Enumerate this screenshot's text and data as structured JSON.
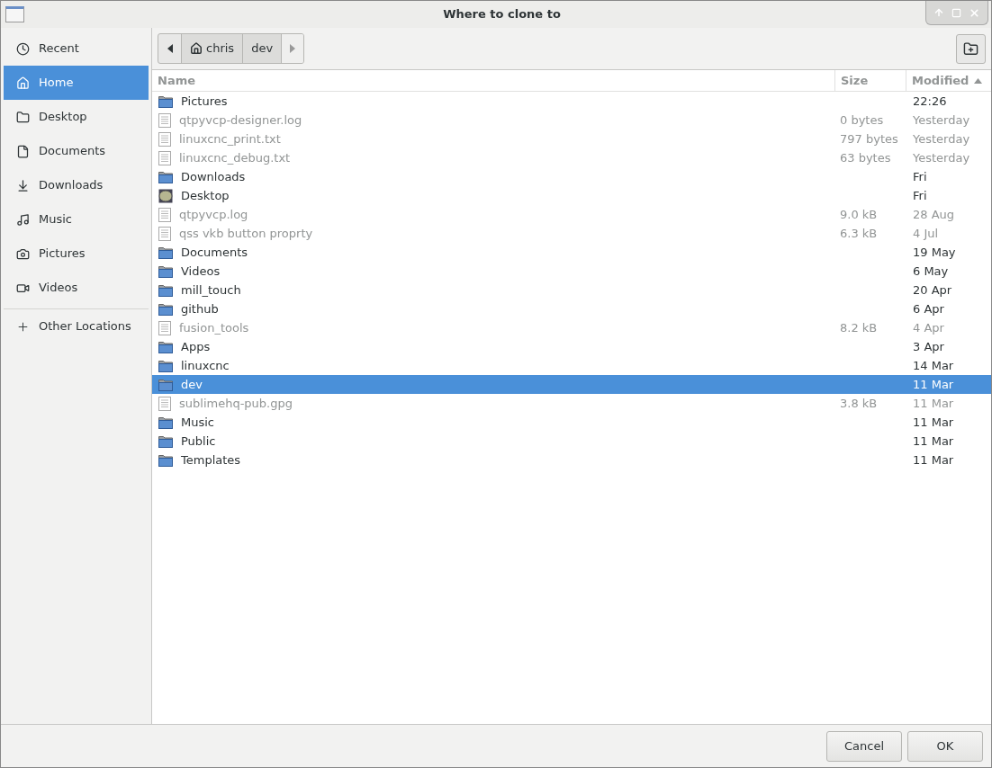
{
  "window": {
    "title": "Where to clone to"
  },
  "sidebar": {
    "items": [
      {
        "label": "Recent",
        "kind": "recent",
        "selected": false
      },
      {
        "label": "Home",
        "kind": "home",
        "selected": true
      },
      {
        "label": "Desktop",
        "kind": "desktop",
        "selected": false
      },
      {
        "label": "Documents",
        "kind": "documents",
        "selected": false
      },
      {
        "label": "Downloads",
        "kind": "downloads",
        "selected": false
      },
      {
        "label": "Music",
        "kind": "music",
        "selected": false
      },
      {
        "label": "Pictures",
        "kind": "pictures",
        "selected": false
      },
      {
        "label": "Videos",
        "kind": "videos",
        "selected": false
      }
    ],
    "other": {
      "label": "Other Locations"
    }
  },
  "path_bar": {
    "segments": [
      {
        "label": "chris",
        "kind": "home"
      },
      {
        "label": "dev",
        "kind": "folder"
      }
    ]
  },
  "table": {
    "columns": [
      {
        "label": "Name",
        "sorted": false
      },
      {
        "label": "Size",
        "sorted": false
      },
      {
        "label": "Modified",
        "sorted": true
      }
    ],
    "rows": [
      {
        "name": "Pictures",
        "size": "",
        "modified": "22:26",
        "kind": "folder",
        "disabled": false,
        "selected": false
      },
      {
        "name": "qtpyvcp-designer.log",
        "size": "0 bytes",
        "modified": "Yesterday",
        "kind": "file",
        "disabled": true,
        "selected": false
      },
      {
        "name": "linuxcnc_print.txt",
        "size": "797 bytes",
        "modified": "Yesterday",
        "kind": "file",
        "disabled": true,
        "selected": false
      },
      {
        "name": "linuxcnc_debug.txt",
        "size": "63 bytes",
        "modified": "Yesterday",
        "kind": "file",
        "disabled": true,
        "selected": false
      },
      {
        "name": "Downloads",
        "size": "",
        "modified": "Fri",
        "kind": "folder",
        "disabled": false,
        "selected": false
      },
      {
        "name": "Desktop",
        "size": "",
        "modified": "Fri",
        "kind": "desktop",
        "disabled": false,
        "selected": false
      },
      {
        "name": "qtpyvcp.log",
        "size": "9.0 kB",
        "modified": "28 Aug",
        "kind": "file",
        "disabled": true,
        "selected": false
      },
      {
        "name": "qss vkb button proprty",
        "size": "6.3 kB",
        "modified": "4 Jul",
        "kind": "file",
        "disabled": true,
        "selected": false
      },
      {
        "name": "Documents",
        "size": "",
        "modified": "19 May",
        "kind": "folder",
        "disabled": false,
        "selected": false
      },
      {
        "name": "Videos",
        "size": "",
        "modified": "6 May",
        "kind": "folder",
        "disabled": false,
        "selected": false
      },
      {
        "name": "mill_touch",
        "size": "",
        "modified": "20 Apr",
        "kind": "folder",
        "disabled": false,
        "selected": false
      },
      {
        "name": "github",
        "size": "",
        "modified": "6 Apr",
        "kind": "folder",
        "disabled": false,
        "selected": false
      },
      {
        "name": "fusion_tools",
        "size": "8.2 kB",
        "modified": "4 Apr",
        "kind": "file",
        "disabled": true,
        "selected": false
      },
      {
        "name": "Apps",
        "size": "",
        "modified": "3 Apr",
        "kind": "folder",
        "disabled": false,
        "selected": false
      },
      {
        "name": "linuxcnc",
        "size": "",
        "modified": "14 Mar",
        "kind": "folder",
        "disabled": false,
        "selected": false
      },
      {
        "name": "dev",
        "size": "",
        "modified": "11 Mar",
        "kind": "folder",
        "disabled": false,
        "selected": true
      },
      {
        "name": "sublimehq-pub.gpg",
        "size": "3.8 kB",
        "modified": "11 Mar",
        "kind": "file",
        "disabled": true,
        "selected": false
      },
      {
        "name": "Music",
        "size": "",
        "modified": "11 Mar",
        "kind": "folder",
        "disabled": false,
        "selected": false
      },
      {
        "name": "Public",
        "size": "",
        "modified": "11 Mar",
        "kind": "folder",
        "disabled": false,
        "selected": false
      },
      {
        "name": "Templates",
        "size": "",
        "modified": "11 Mar",
        "kind": "folder",
        "disabled": false,
        "selected": false
      }
    ]
  },
  "buttons": [
    {
      "label": "Cancel"
    },
    {
      "label": "OK"
    }
  ]
}
